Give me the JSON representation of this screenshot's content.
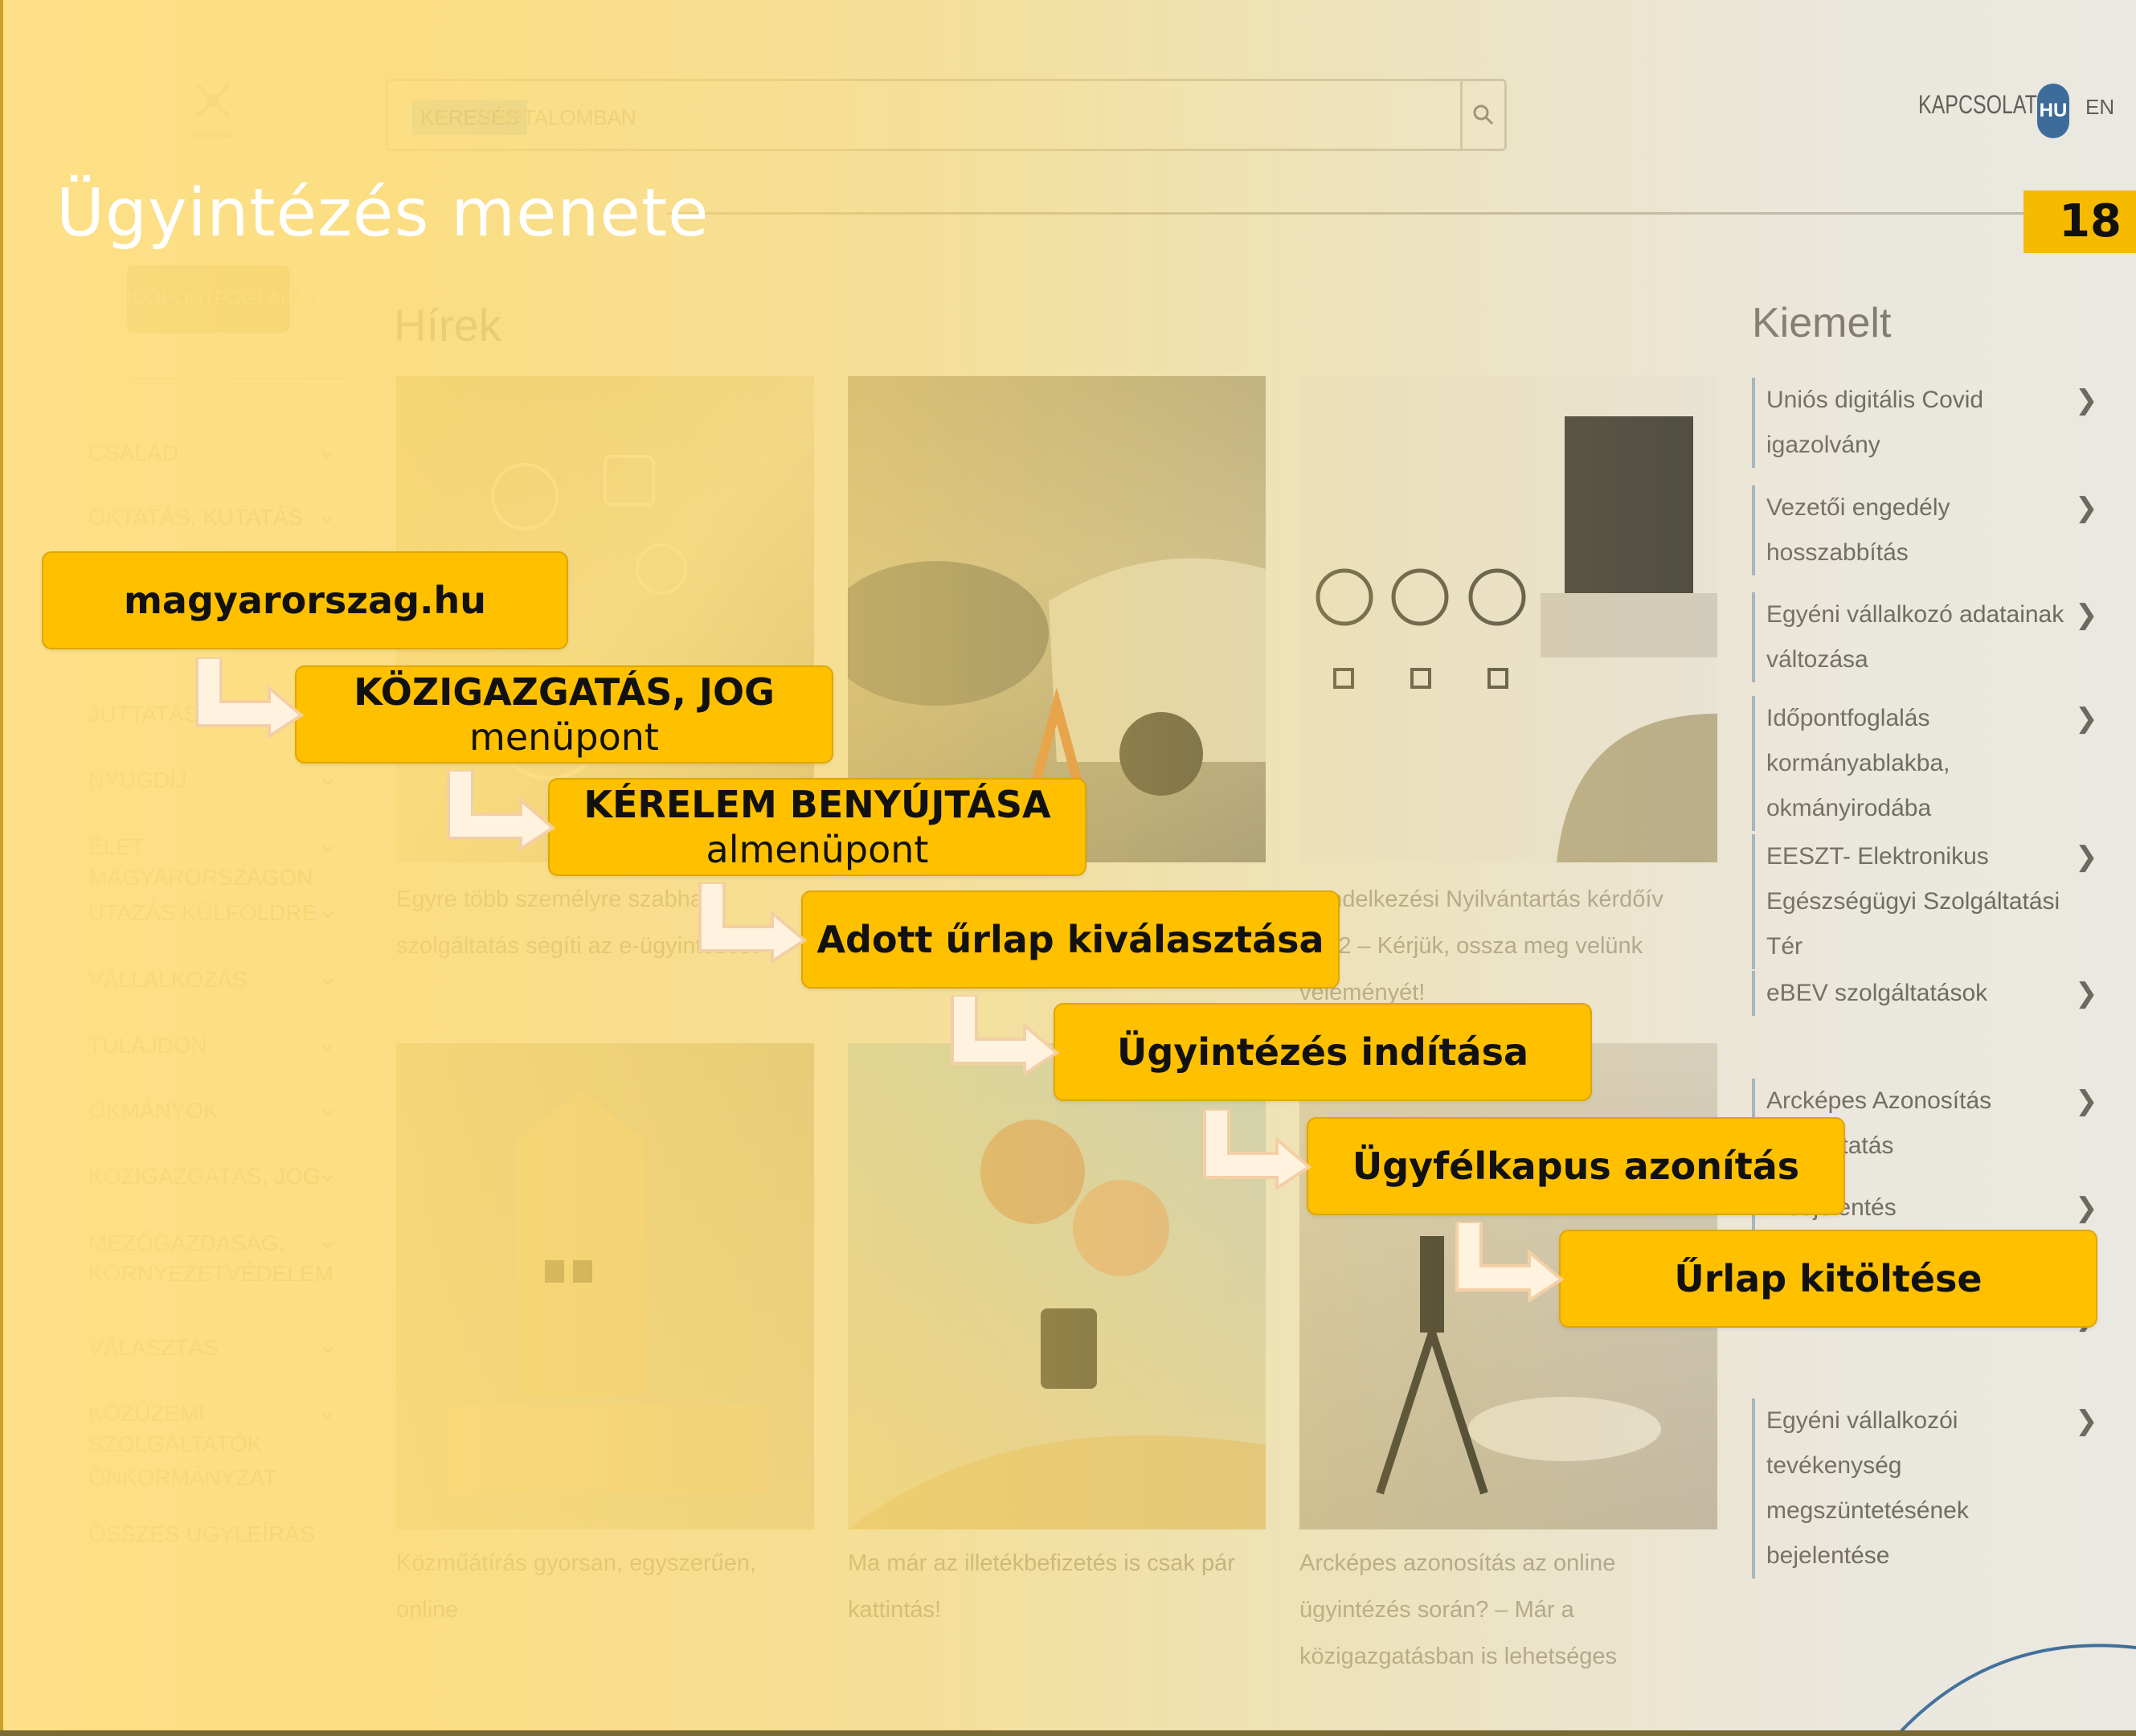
{
  "slide": {
    "title": "Ügyintézés menete",
    "page_number": "18"
  },
  "header": {
    "search_tag": "KERESÉS",
    "search_placeholder": "TARTALOMBAN",
    "contact": "KAPCSOLAT",
    "lang_hu": "HU",
    "lang_en": "EN"
  },
  "sidebar": {
    "appointment_button": "IDŐPONTFOGLALÁS",
    "items": [
      {
        "label": "CSALÁD"
      },
      {
        "label": "OKTATÁS, KUTATÁS"
      },
      {
        "label": ""
      },
      {
        "label": "JUTTATÁS, SE"
      },
      {
        "label": "NYUGDÍJ"
      },
      {
        "label": "ÉLET MAGYARORSZÁGON"
      },
      {
        "label": "UTAZÁS KÜLFÖLDRE"
      },
      {
        "label": "VÁLLALKOZÁS"
      },
      {
        "label": "TULAJDON"
      },
      {
        "label": "OKMÁNYOK"
      },
      {
        "label": "KÖZIGAZGATÁS, JOG"
      },
      {
        "label": "MEZŐGAZDASÁG, KÖRNYEZETVÉDELEM"
      },
      {
        "label": "VÁLASZTÁS"
      },
      {
        "label": "KÖZÜZEMI SZOLGÁLTATÓK"
      },
      {
        "label": "ÖNKORMÁNYZAT"
      },
      {
        "label": "ÖSSZES ÜGYLEÍRÁS"
      }
    ]
  },
  "news": {
    "heading": "Hírek",
    "cards": [
      {
        "caption": "Egyre több személyre szabható szolgáltatás segíti az e-ügyintézést"
      },
      {
        "caption": ""
      },
      {
        "caption": "Rendelkezési Nyilvántartás kérdőív 2022 – Kérjük, ossza meg velünk véleményét!"
      },
      {
        "caption": "Közműátírás gyorsan, egyszerűen, online"
      },
      {
        "caption": "Ma már az illetékbefizetés is csak pár kattintás!"
      },
      {
        "caption": "Arcképes azonosítás az online ügyintézés során? – Már a közigazgatásban is lehetséges"
      }
    ]
  },
  "featured": {
    "heading": "Kiemelt",
    "items": [
      {
        "label": "Uniós digitális Covid igazolvány"
      },
      {
        "label": "Vezetői engedély hosszabbítás"
      },
      {
        "label": "Egyéni vállalkozó adatainak változása"
      },
      {
        "label": "Időpontfoglalás kormányablakba, okmányirodába"
      },
      {
        "label": "EESZT- Elektronikus Egészségügyi Szolgáltatási Tér"
      },
      {
        "label": "eBEV szolgáltatások"
      },
      {
        "label": "Arcképes Azonosítás szolgáltatás"
      },
      {
        "label": "...bejelentés"
      },
      {
        "label": ""
      },
      {
        "label": "Egyéni vállalkozói tevékenység megszüntetésének bejelentése"
      }
    ]
  },
  "steps": [
    {
      "title": "magyarorszag.hu",
      "sub": ""
    },
    {
      "title": "KÖZIGAZGATÁS, JOG",
      "sub": "menüpont"
    },
    {
      "title": "KÉRELEM BENYÚJTÁSA",
      "sub": "almenüpont"
    },
    {
      "title": "Adott űrlap kiválasztása",
      "sub": ""
    },
    {
      "title": "Ügyintézés indítása",
      "sub": ""
    },
    {
      "title": "Ügyfélkapus azonítás",
      "sub": ""
    },
    {
      "title": "Űrlap kitöltése",
      "sub": ""
    }
  ],
  "colors": {
    "step_fill": "#ffc000",
    "page_badge": "#f6bb00",
    "overlay_yellow": "#ffdf80"
  }
}
